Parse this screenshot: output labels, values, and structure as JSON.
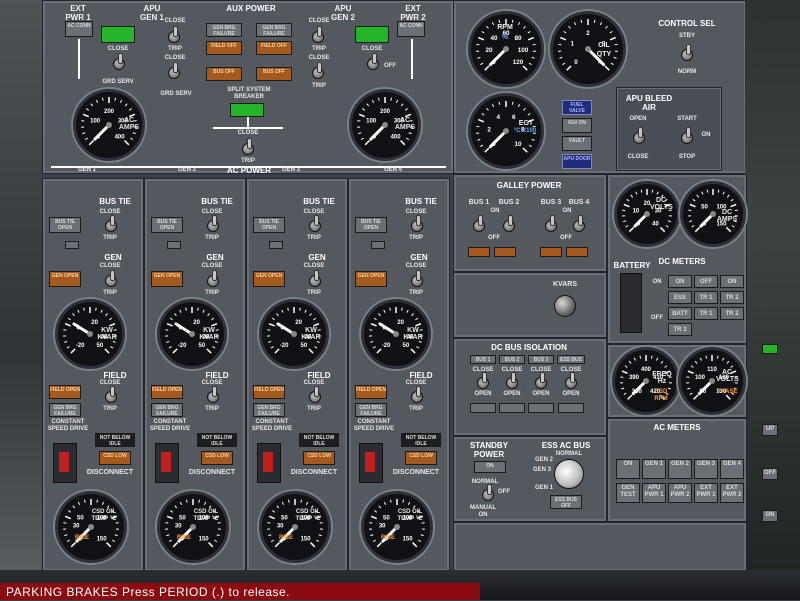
{
  "aux_power": {
    "title": "AUX POWER",
    "ext_pwr_1": "EXT PWR 1",
    "ext_pwr_2": "EXT PWR 2",
    "apu_gen_1": "APU GEN 1",
    "apu_gen_2": "APU GEN 2",
    "ac_conn": "AC CONN",
    "close": "CLOSE",
    "trip": "TRIP",
    "grd_serv": "GRD SERV",
    "off": "OFF",
    "gen_brg_failure": "GEN BRG FAILURE",
    "field_off": "FIELD OFF",
    "bus_off": "BUS OFF",
    "split_system_breaker": "SPLIT SYSTEM BREAKER",
    "ac_amps": "AC AMPS",
    "ac_power": "AC POWER",
    "gen_labels": [
      "GEN 1",
      "GEN 2",
      "GEN 3",
      "GEN 4"
    ]
  },
  "engine_gauges": {
    "rpm_label": "RPM",
    "rpm_unit": "%",
    "oil_qty_label": "OIL QTY",
    "egt_label": "EGT",
    "egt_unit": "°C X100",
    "fuel_valve": "FUEL VALVE",
    "ign_on": "IGN ON",
    "ign_fault": "FAULT",
    "apu_door": "APU DOOR"
  },
  "control_sel": {
    "title": "CONTROL SEL",
    "stby": "STBY",
    "norm": "NORM"
  },
  "apu_bleed": {
    "title": "APU BLEED AIR",
    "open": "OPEN",
    "close": "CLOSE",
    "start": "START",
    "on": "ON",
    "stop": "STOP"
  },
  "gen_panels": [
    {
      "bus_tie": "BUS TIE",
      "close": "CLOSE",
      "trip": "TRIP",
      "gen": "GEN",
      "field": "FIELD",
      "kw_kvar": "KW KVAR",
      "csd": "CONSTANT SPEED DRIVE",
      "disconnect": "DISCONNECT",
      "not_below": "NOT BELOW IDLE",
      "csd_oil": "CSD OIL TEMP °C",
      "rise": "RISE",
      "bus_tie_open": "BUS TIE OPEN",
      "gen_open": "GEN OPEN",
      "field_open": "FIELD OPEN",
      "gen_brg": "GEN BRG FAILURE",
      "csd_low": "CSD LOW"
    },
    {
      "bus_tie": "BUS TIE",
      "close": "CLOSE",
      "trip": "TRIP",
      "gen": "GEN",
      "field": "FIELD",
      "kw_kvar": "KW KVAR",
      "csd": "CONSTANT SPEED DRIVE",
      "disconnect": "DISCONNECT",
      "not_below": "NOT BELOW IDLE",
      "csd_oil": "CSD OIL TEMP °C",
      "rise": "RISE",
      "bus_tie_open": "BUS TIE OPEN",
      "gen_open": "GEN OPEN",
      "field_open": "FIELD OPEN",
      "gen_brg": "GEN BRG FAILURE",
      "csd_low": "CSD LOW"
    },
    {
      "bus_tie": "BUS TIE",
      "close": "CLOSE",
      "trip": "TRIP",
      "gen": "GEN",
      "field": "FIELD",
      "kw_kvar": "KW KVAR",
      "csd": "CONSTANT SPEED DRIVE",
      "disconnect": "DISCONNECT",
      "not_below": "NOT BELOW IDLE",
      "csd_oil": "CSD OIL TEMP °C",
      "rise": "RISE",
      "bus_tie_open": "BUS TIE OPEN",
      "gen_open": "GEN OPEN",
      "field_open": "FIELD OPEN",
      "gen_brg": "GEN BRG FAILURE",
      "csd_low": "CSD LOW"
    },
    {
      "bus_tie": "BUS TIE",
      "close": "CLOSE",
      "trip": "TRIP",
      "gen": "GEN",
      "field": "FIELD",
      "kw_kvar": "KW KVAR",
      "csd": "CONSTANT SPEED DRIVE",
      "disconnect": "DISCONNECT",
      "not_below": "NOT BELOW IDLE",
      "csd_oil": "CSD OIL TEMP °C",
      "rise": "RISE",
      "bus_tie_open": "BUS TIE OPEN",
      "gen_open": "GEN OPEN",
      "field_open": "FIELD OPEN",
      "gen_brg": "GEN BRG FAILURE",
      "csd_low": "CSD LOW"
    }
  ],
  "galley_power": {
    "title": "GALLEY POWER",
    "bus_labels": [
      "BUS 1",
      "BUS 2",
      "BUS 3",
      "BUS 4"
    ],
    "on": "ON",
    "off": "OFF"
  },
  "kvars": "KVARS",
  "dc_bus_isolation": {
    "title": "DC BUS ISOLATION",
    "bus_labels": [
      "BUS 1",
      "BUS 2",
      "BUS 3",
      "ESS BUS"
    ],
    "close": "CLOSE",
    "open": "OPEN"
  },
  "dc_meters": {
    "title": "DC METERS",
    "battery": "BATTERY",
    "on": "ON",
    "off": "OFF",
    "dc_volts": "DC VOLTS",
    "dc_amps": "DC AMPS",
    "buttons": [
      "ON",
      "OFF",
      "ON",
      "ESS BATT",
      "TR 1",
      "TR 2",
      "BATT",
      "TR 1",
      "TR 2",
      "TR 3"
    ]
  },
  "freq_volts": {
    "freq": "FREQ Hz",
    "csd_rpm": "CSD RPM",
    "ac_volts": "AC VOLTS",
    "ac_volts_sub": "PHASE"
  },
  "ac_meters": {
    "title": "AC METERS",
    "buttons": [
      "ON",
      "GEN 1",
      "GEN 2",
      "GEN 3",
      "GEN 4",
      "GEN TEST",
      "APU PWR 1",
      "APU PWR 2",
      "EXT PWR 1",
      "EXT PWR 2"
    ]
  },
  "standby_power": {
    "title": "STANDBY POWER",
    "on": "ON",
    "normal": "NORMAL",
    "off": "OFF",
    "manual_on": "MANUAL ON"
  },
  "ess_ac_bus": {
    "title": "ESS AC BUS",
    "normal": "NORMAL",
    "gen_2": "GEN 2",
    "gen_3": "GEN 3",
    "gen_1": "GEN 1",
    "ess_bus_off": "ESS BUS OFF"
  },
  "side_tags": {
    "up": "UP",
    "off": "OFF",
    "on": "ON"
  },
  "status_bar": {
    "message": "PARKING BRAKES   Press PERIOD (.) to release."
  },
  "colors": {
    "panel": "#54585f",
    "amber_light": "#a45a1e",
    "green_light": "#26b52a",
    "status_red": "#8b0b10"
  },
  "gauge_data": {
    "ac_amps": {
      "scale": [
        0,
        100,
        200,
        300,
        400
      ],
      "needle_value": 0
    },
    "rpm": {
      "scale": [
        0,
        20,
        40,
        60,
        80,
        100,
        120
      ],
      "needle_value": 0
    },
    "oil_qty": {
      "scale": [
        0,
        1,
        2,
        3,
        4
      ],
      "needle_value": 4
    },
    "egt": {
      "scale": [
        0,
        2,
        4,
        6,
        8,
        10
      ],
      "needle_value": 0
    },
    "kw_kvar": {
      "scale": [
        -20,
        0,
        20,
        40,
        50
      ],
      "needle_value": 0
    },
    "csd_oil_temp": {
      "scale": [
        0,
        30,
        50,
        100,
        150
      ],
      "needle_value": 0
    },
    "dc_volts": {
      "scale": [
        0,
        10,
        20,
        30,
        40
      ],
      "needle_value": 0
    },
    "dc_amps": {
      "scale": [
        0,
        50,
        100,
        150
      ],
      "needle_value": 0
    },
    "freq": {
      "scale": [
        380,
        390,
        400,
        410,
        420
      ],
      "needle_value": 380
    },
    "ac_volts": {
      "scale": [
        90,
        100,
        110,
        120,
        130
      ],
      "needle_value": 90
    }
  }
}
